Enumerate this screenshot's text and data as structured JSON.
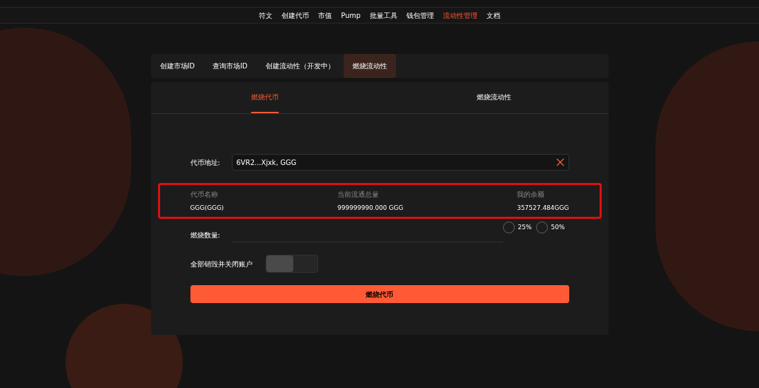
{
  "nav": [
    {
      "label": "符文",
      "selected": false
    },
    {
      "label": "创建代币",
      "selected": false
    },
    {
      "label": "市值",
      "selected": false
    },
    {
      "label": "Pump",
      "selected": false
    },
    {
      "label": "批量工具",
      "selected": false
    },
    {
      "label": "钱包管理",
      "selected": false
    },
    {
      "label": "流动性管理",
      "selected": true
    },
    {
      "label": "文档",
      "selected": false
    }
  ],
  "tabs": [
    {
      "label": "创建市场ID",
      "selected": false
    },
    {
      "label": "查询市场ID",
      "selected": false
    },
    {
      "label": "创建流动性（开发中）",
      "selected": false
    },
    {
      "label": "燃烧流动性",
      "selected": true
    }
  ],
  "subtabs": [
    {
      "label": "燃烧代币",
      "selected": true
    },
    {
      "label": "燃烧流动性",
      "selected": false
    }
  ],
  "address": {
    "label": "代币地址:",
    "value": "6VR2...Xjxk, GGG"
  },
  "info": [
    {
      "label": "代币名称",
      "value": "GGG(GGG)"
    },
    {
      "label": "当前流通总量",
      "value": "999999990.000 GGG"
    },
    {
      "label": "我的余额",
      "value": "357527.484GGG"
    }
  ],
  "amount": {
    "label": "燃烧数量:",
    "options": [
      {
        "label": "25%",
        "selected": false
      },
      {
        "label": "50%",
        "selected": false
      }
    ]
  },
  "close_all": {
    "label": "全部销毁并关闭账户",
    "on": false
  },
  "submit": "燃烧代币"
}
